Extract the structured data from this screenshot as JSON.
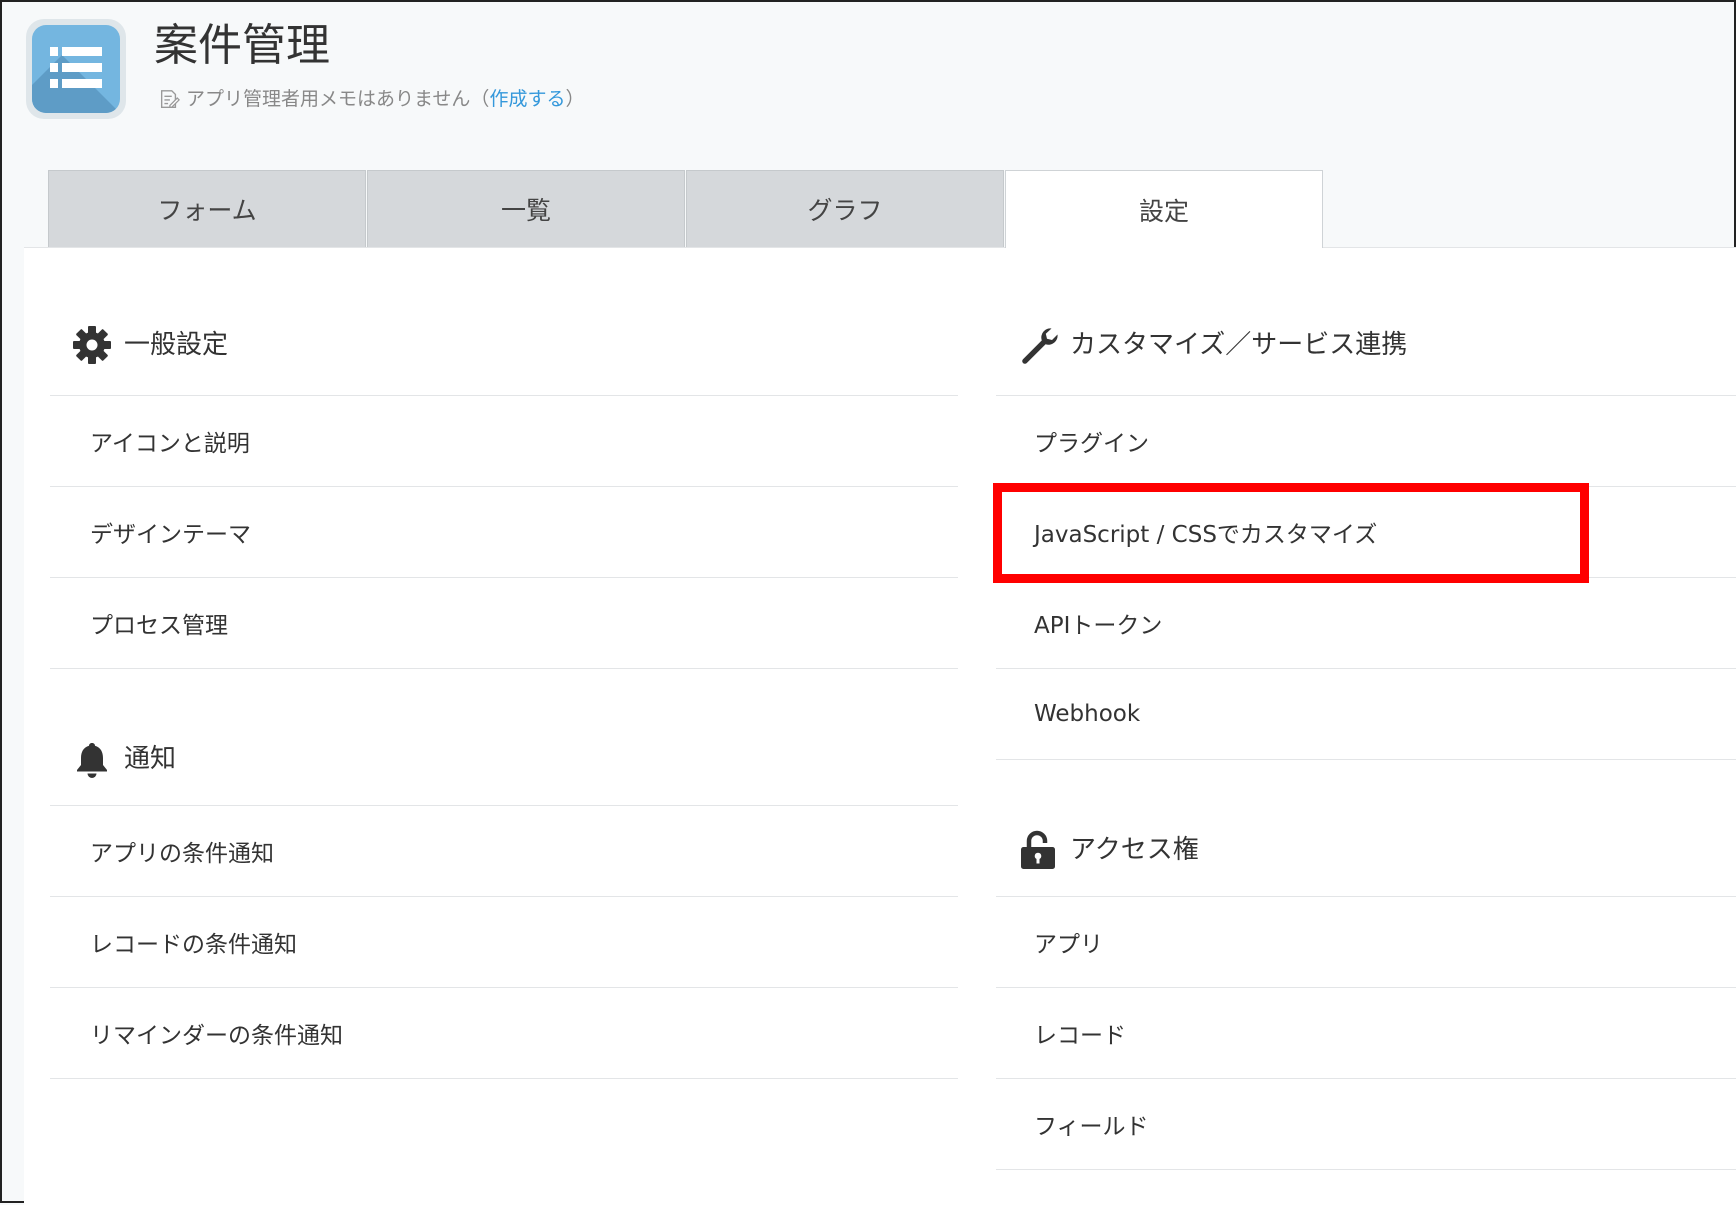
{
  "app": {
    "title": "案件管理",
    "memo_text": "アプリ管理者用メモはありません（",
    "memo_link": "作成する",
    "memo_close": "）"
  },
  "tabs": [
    {
      "label": "フォーム",
      "active": false
    },
    {
      "label": "一覧",
      "active": false
    },
    {
      "label": "グラフ",
      "active": false
    },
    {
      "label": "設定",
      "active": true
    }
  ],
  "left": {
    "general": {
      "title": "一般設定",
      "icon": "gear-icon",
      "items": [
        "アイコンと説明",
        "デザインテーマ",
        "プロセス管理"
      ]
    },
    "notifications": {
      "title": "通知",
      "icon": "bell-icon",
      "items": [
        "アプリの条件通知",
        "レコードの条件通知",
        "リマインダーの条件通知"
      ]
    }
  },
  "right": {
    "customize": {
      "title": "カスタマイズ／サービス連携",
      "icon": "wrench-icon",
      "items": [
        "プラグイン",
        "JavaScript / CSSでカスタマイズ",
        "APIトークン",
        "Webhook"
      ]
    },
    "access": {
      "title": "アクセス権",
      "icon": "unlocked-padlock-icon",
      "items": [
        "アプリ",
        "レコード",
        "フィールド"
      ]
    }
  },
  "colors": {
    "highlight": "#ff0000",
    "link": "#3498db",
    "tab_inactive": "#d5d8db",
    "app_icon": "#74b6e0"
  }
}
